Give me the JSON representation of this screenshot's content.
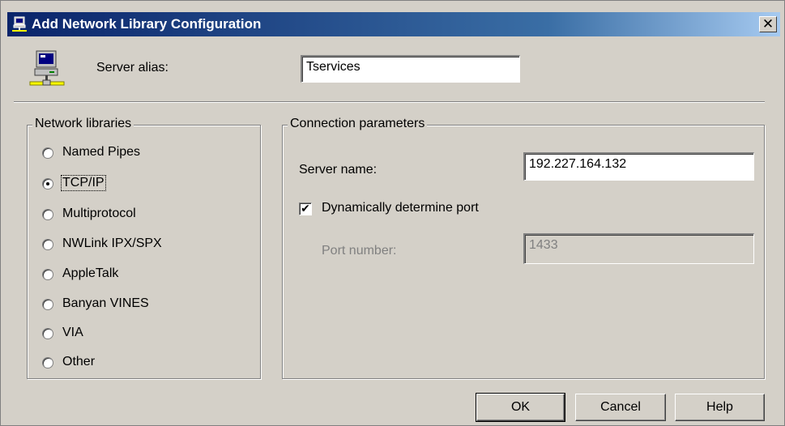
{
  "window": {
    "title": "Add Network Library Configuration",
    "close_glyph": "✕"
  },
  "alias": {
    "label": "Server alias:",
    "value": "Tservices"
  },
  "libraries": {
    "group_label": "Network libraries",
    "selected": "TCP/IP",
    "items": [
      {
        "label": "Named Pipes",
        "selected": false
      },
      {
        "label": "TCP/IP",
        "selected": true
      },
      {
        "label": "Multiprotocol",
        "selected": false
      },
      {
        "label": "NWLink IPX/SPX",
        "selected": false
      },
      {
        "label": "AppleTalk",
        "selected": false
      },
      {
        "label": "Banyan VINES",
        "selected": false
      },
      {
        "label": "VIA",
        "selected": false
      },
      {
        "label": "Other",
        "selected": false
      }
    ]
  },
  "connection": {
    "group_label": "Connection parameters",
    "server_name_label": "Server name:",
    "server_name_value": "192.227.164.132",
    "dynamic_port_label": "Dynamically determine port",
    "dynamic_port_checked": true,
    "check_glyph": "✔",
    "port_label": "Port number:",
    "port_value": "1433"
  },
  "buttons": {
    "ok": "OK",
    "cancel": "Cancel",
    "help": "Help"
  },
  "icons": {
    "title_icon": "network-computer-icon",
    "computer_icon": "computer-network-icon"
  },
  "colors": {
    "face": "#d4d0c8",
    "title_start": "#0a246a",
    "title_end": "#a6caf0",
    "disabled_text": "#808080"
  }
}
